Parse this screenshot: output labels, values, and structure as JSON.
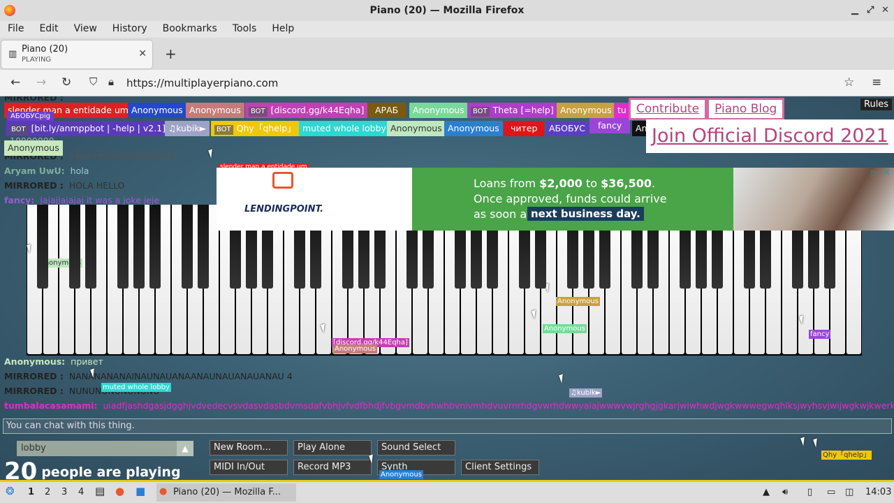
{
  "window": {
    "title": "Piano (20) — Mozilla Firefox"
  },
  "menu": [
    "File",
    "Edit",
    "View",
    "History",
    "Bookmarks",
    "Tools",
    "Help"
  ],
  "tab": {
    "title": "Piano (20)",
    "subtitle": "PLAYING"
  },
  "nav": {
    "url": "https://multiplayerpiano.com"
  },
  "names": {
    "row1": [
      {
        "text": "slender man a entidade um",
        "color": "#e02020"
      },
      {
        "text": "Anonymous",
        "color": "#2448c8"
      },
      {
        "text": "Anonymous",
        "color": "#c77a7a"
      },
      {
        "bot": "BOT",
        "text": "[discord.gg/k44Eqha]",
        "color": "#c43fb4"
      },
      {
        "text": "АРАБ",
        "color": "#7a5a10"
      },
      {
        "text": "Anonymous",
        "color": "#79d99a"
      },
      {
        "bot": "BOT",
        "text": "Theta [=help]",
        "color": "#b03bcc"
      },
      {
        "text": "Anonymous",
        "color": "#c8a040"
      },
      {
        "text": "tu",
        "color": "#e02cd0"
      }
    ],
    "row1b": {
      "text": "АБОБУСpig",
      "color": "#6b3fc8"
    },
    "row2": [
      {
        "bot": "BOT",
        "text": "[bit.ly/anmppbot | -help | v2.1]",
        "color": "#5a3ab8"
      },
      {
        "text": "♫kubik►",
        "color": "#9da3c7"
      },
      {
        "bot": "BOT",
        "text": "Qhy「qhelp」",
        "color": "#f0c80a"
      },
      {
        "text": "muted whole lobby",
        "color": "#2bd9d0"
      },
      {
        "text": "Anonymous",
        "color": "#c0e8c0"
      },
      {
        "text": "Anonymous",
        "color": "#2b7ed0"
      },
      {
        "text": "читер",
        "color": "#e01515"
      },
      {
        "text": "АБОБУС",
        "color": "#5a3fc0"
      },
      {
        "text": "fancy",
        "color": "#9a45d8"
      },
      {
        "text": "An",
        "color": "#111"
      }
    ],
    "row3": {
      "text": "Anonymous",
      "color": "#c8e8c0"
    }
  },
  "links": {
    "contribute": "Contribute",
    "blog": "Piano Blog",
    "discord": "Join Official Discord 2021",
    "rules": "Rules"
  },
  "ad": {
    "brand": "LENDINGPOINT.",
    "line1_pre": "Loans from ",
    "line1_a": "$2,000",
    "line1_mid": " to ",
    "line1_b": "$36,500",
    "line1_post": ".",
    "line2": "Once approved, funds could arrive",
    "line3": "as soon as",
    "line3_hl": "next business day."
  },
  "chat": [
    {
      "user": "MIRRORED :",
      "msg": "",
      "color": "#222"
    },
    {
      "user": "",
      "msg": "10000000",
      "color": "#aab"
    },
    {
      "user": "MIRRORED :",
      "msg": "Y999999999999999999",
      "color": "#222"
    },
    {
      "user": "Aryam UwU:",
      "msg": "hola",
      "color": "#7fae9a"
    },
    {
      "user": "MIRRORED :",
      "msg": "HOLA HELLO",
      "color": "#222"
    },
    {
      "user": "fancy:",
      "msg": "jajajjajajaj it was a joke jeje",
      "color": "#9a5ad8"
    },
    {
      "user": "Anonymous:",
      "msg": "привет",
      "color": "#c8e8c0"
    },
    {
      "user": "MIRRORED :",
      "msg": "NANANANANAINAUNAUANAANAUNAUANAUANAU 4",
      "color": "#222"
    },
    {
      "user": "MIRRORED :",
      "msg": "NUNUNUNUNUNUNU",
      "color": "#222"
    },
    {
      "user": "tumbalacasamami:",
      "msg": "uiadfjashdgasjdgghjvdvedecvsvdasvdasbdvmsdafvbhjvfvdfbhdjfvbgvmdbvhwhbvnivmhdvuvrnrhdgvwrhdwwyaiajwwwvwjrghgjgkarjwiwhwdjwgkwwwegwqhlksjwyhsvjwijwgkwjkwerkjwgkw",
      "color": "#e02cd0"
    }
  ],
  "cursor_tags": [
    {
      "text": "slender man a entidade um",
      "color": "#e02020"
    },
    {
      "text": "Anonymous",
      "color": "#c0e8c0"
    },
    {
      "text": "Anonymous",
      "color": "#c8a040"
    },
    {
      "text": "Anonymous",
      "color": "#79d99a"
    },
    {
      "text": "[discord.gg/k44Eqha]",
      "color": "#c43fb4"
    },
    {
      "text": "Anonymous",
      "color": "#c77a7a"
    },
    {
      "text": "fancy",
      "color": "#9a45d8"
    },
    {
      "text": "muted whole lobby",
      "color": "#2bd9d0"
    },
    {
      "text": "♫kubik►",
      "color": "#9da3c7"
    },
    {
      "text": "Anonymous",
      "color": "#2b7ed0"
    },
    {
      "text": "Qhy「qhelp」",
      "color": "#f0c80a"
    }
  ],
  "chat_placeholder": "You can chat with this thing.",
  "lobby": "lobby",
  "count": {
    "number": "20",
    "text": "people are playing"
  },
  "buttons": {
    "new_room": "New Room...",
    "play_alone": "Play Alone",
    "sound_select": "Sound Select",
    "midi": "MIDI In/Out",
    "record": "Record MP3",
    "synth": "Synth",
    "client_settings": "Client Settings"
  },
  "taskbar": {
    "workspaces": [
      "1",
      "2",
      "3",
      "4"
    ],
    "window": "Piano (20) — Mozilla F...",
    "clock": "14:03"
  }
}
